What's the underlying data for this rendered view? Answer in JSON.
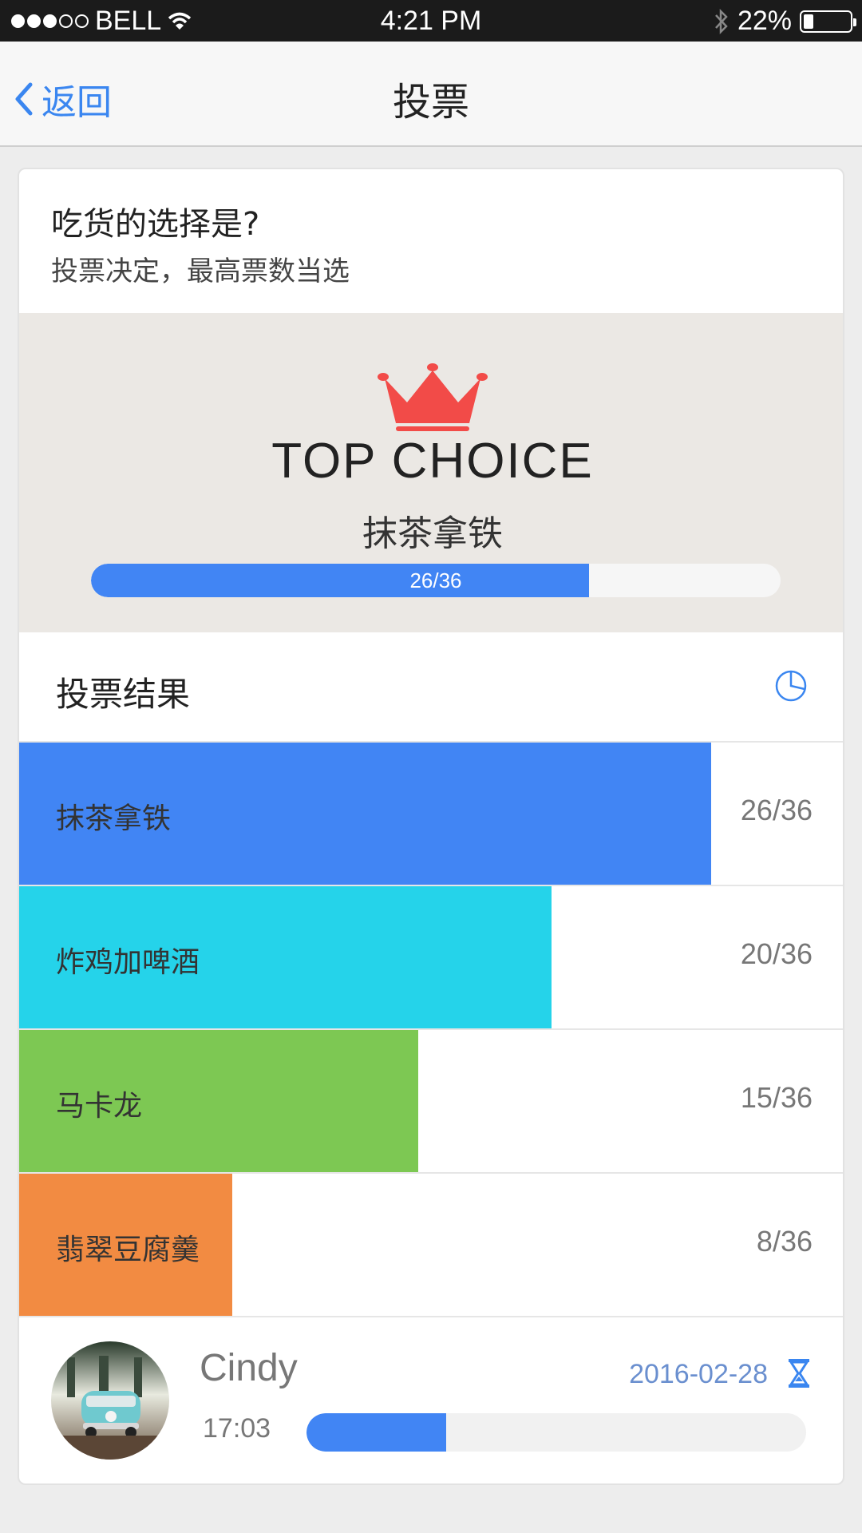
{
  "status_bar": {
    "carrier": "BELL",
    "time": "4:21 PM",
    "battery": "22%",
    "battery_level": 0.22,
    "signal_bars": 3,
    "signal_total": 5
  },
  "nav": {
    "back_label": "返回",
    "title": "投票"
  },
  "question": {
    "title": "吃货的选择是?",
    "subtitle": "投票决定，最高票数当选"
  },
  "top_choice": {
    "heading": "TOP  CHOICE",
    "name": "抹茶拿铁",
    "count_text": "26/36",
    "fraction": 0.7222,
    "crown_color": "#f24b48"
  },
  "results": {
    "title": "投票结果",
    "items": [
      {
        "label": "抹茶拿铁",
        "count_text": "26/36",
        "fraction": 0.7222,
        "color": "#4185f4"
      },
      {
        "label": "炸鸡加啤酒",
        "count_text": "20/36",
        "fraction": 0.5556,
        "color": "#25d3ea"
      },
      {
        "label": "马卡龙",
        "count_text": "15/36",
        "fraction": 0.4167,
        "color": "#7dc853"
      },
      {
        "label": "翡翠豆腐羹",
        "count_text": "8/36",
        "fraction": 0.2222,
        "color": "#f28b42"
      }
    ]
  },
  "user": {
    "name": "Cindy",
    "date": "2016-02-28",
    "time": "17:03",
    "progress_fraction": 0.28
  },
  "colors": {
    "accent": "#4185f4",
    "back_link": "#3a86f0"
  }
}
